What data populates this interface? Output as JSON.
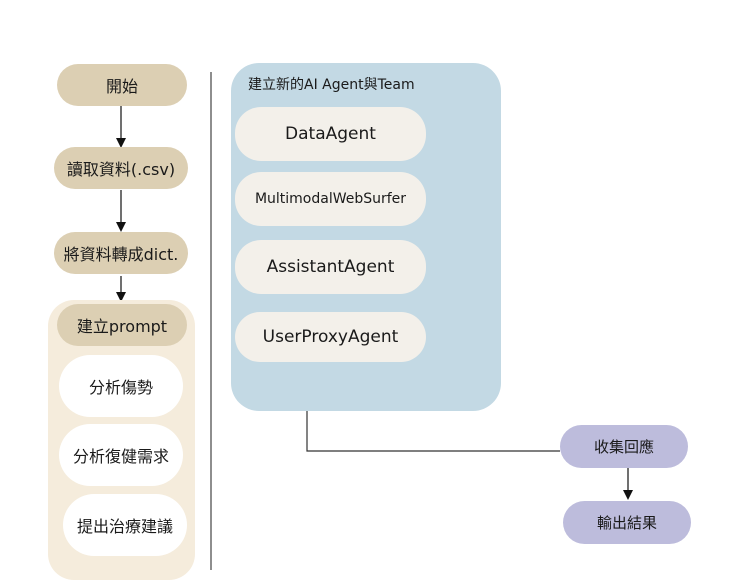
{
  "left_flow": {
    "start": "開始",
    "read_data": "讀取資料(.csv)",
    "to_dict": "將資料轉成dict.",
    "build_prompt": "建立prompt",
    "prompts": [
      "分析傷勢",
      "分析復健需求",
      "提出治療建議"
    ]
  },
  "agent_panel": {
    "title": "建立新的AI Agent與Team",
    "agents": [
      "DataAgent",
      "MultimodalWebSurfer",
      "AssistantAgent",
      "UserProxyAgent"
    ]
  },
  "right_flow": {
    "collect": "收集回應",
    "output": "輸出結果"
  },
  "colors": {
    "tan": "#dccfb3",
    "cream": "#f5ecdc",
    "blue_panel": "#c3d9e4",
    "agent_box": "#f3f0ea",
    "lavender": "#bdbcdc"
  }
}
